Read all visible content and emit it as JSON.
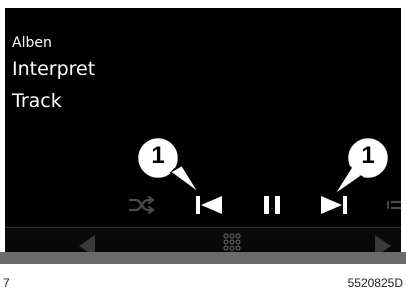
{
  "now_playing": {
    "album": "Alben",
    "artist": "Interpret",
    "track": "Track"
  },
  "controls": {
    "shuffle_icon": "shuffle-icon",
    "prev_icon": "skip-previous-icon",
    "pause_icon": "pause-icon",
    "next_icon": "skip-next-icon",
    "repeat_icon": "repeat-icon"
  },
  "nav": {
    "left_icon": "arrow-left-icon",
    "keypad_icon": "keypad-icon",
    "right_icon": "arrow-right-icon"
  },
  "callouts": [
    {
      "label": "1",
      "target": "skip-previous-button"
    },
    {
      "label": "1",
      "target": "skip-next-button"
    }
  ],
  "footer": {
    "page_number": "7",
    "document_code": "5520825D"
  },
  "colors": {
    "screen_bg": "#000000",
    "text": "#ffffff",
    "control_active": "#ffffff",
    "control_inactive": "#4a4a4a",
    "nav_arrow": "#3a3a3a",
    "bottom_bar": "#6b6b6b"
  }
}
